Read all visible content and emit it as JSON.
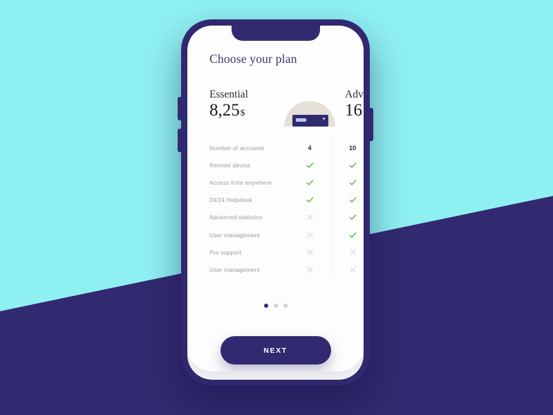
{
  "background": {
    "top_color": "#8FF0F2",
    "bottom_color": "#322A70"
  },
  "device": {
    "frame_color": "#322A70",
    "screen_color": "#FDFDFD"
  },
  "screen": {
    "title": "Choose your plan",
    "plans": [
      {
        "name": "Essential",
        "price": "8,25",
        "currency": "$"
      },
      {
        "name": "Adv",
        "price": "16",
        "currency": ""
      }
    ],
    "illustration": {
      "name": "server-device-illustration",
      "arc_color": "#E6E1D8",
      "device_color": "#322A70"
    },
    "features": [
      {
        "label": "Number of accounts",
        "essential": "4",
        "advanced": "10",
        "type": "value"
      },
      {
        "label": "Remote device",
        "essential": "check",
        "advanced": "check",
        "type": "mark"
      },
      {
        "label": "Access from anywhere",
        "essential": "check",
        "advanced": "check",
        "type": "mark"
      },
      {
        "label": "24/24 Helpdesk",
        "essential": "check",
        "advanced": "check",
        "type": "mark"
      },
      {
        "label": "Advanced statistics",
        "essential": "cross",
        "advanced": "check",
        "type": "mark"
      },
      {
        "label": "User management",
        "essential": "cross",
        "advanced": "check",
        "type": "mark"
      },
      {
        "label": "Pro support",
        "essential": "cross",
        "advanced": "cross",
        "type": "mark"
      },
      {
        "label": "User management",
        "essential": "cross",
        "advanced": "cross",
        "type": "mark"
      }
    ],
    "mark_colors": {
      "check": "#5BC236",
      "cross": "#DCDCE0"
    },
    "pagination": {
      "total": 3,
      "active_index": 0,
      "active_color": "#322A70",
      "inactive_color": "#D2D2D8"
    },
    "next_button": {
      "label": "NEXT",
      "color": "#322A70"
    }
  }
}
